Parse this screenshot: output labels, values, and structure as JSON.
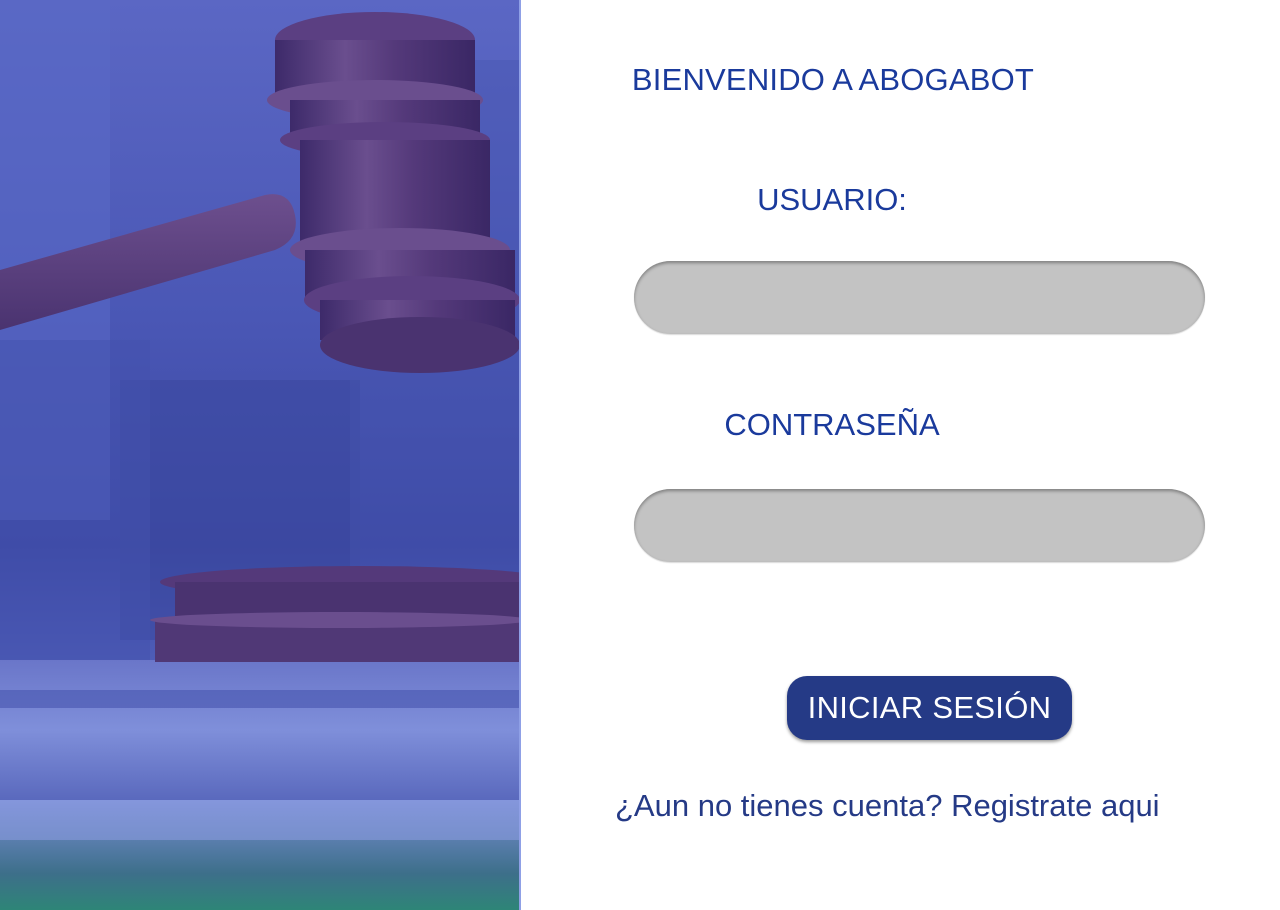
{
  "colors": {
    "accent_text": "#1a3a9c",
    "button_bg": "#253a86",
    "field_bg": "#c3c3c3",
    "hero_tint": "#4a57b5"
  },
  "hero": {
    "image": "gavel-icon"
  },
  "login": {
    "title": "BIENVENIDO A ABOGABOT",
    "user_label": "USUARIO:",
    "user_value": "",
    "password_label": "CONTRASEÑA",
    "password_value": "",
    "submit_label": "INICIAR SESIÓN",
    "register_link": "¿Aun no tienes cuenta? Registrate aqui"
  }
}
